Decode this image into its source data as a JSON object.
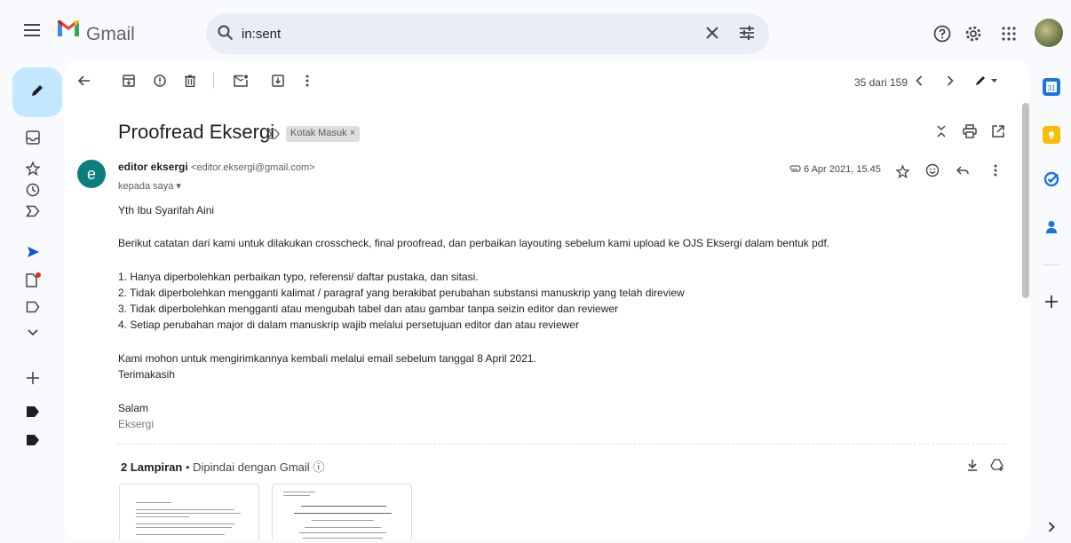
{
  "app": {
    "logo_text": "Gmail"
  },
  "search": {
    "value": "in:sent"
  },
  "toolbar": {
    "counter": "35 dari 159"
  },
  "email": {
    "subject": "Proofread Eksergi",
    "label_chip": "Kotak Masuk ×",
    "sender_avatar_letter": "e",
    "sender_name": "editor eksergi",
    "sender_email": "<editor.eksergi@gmail.com>",
    "to": "kepada saya ▾",
    "date": "6 Apr 2021, 15.45",
    "body": [
      "Yth Ibu Syarifah Aini",
      "Berikut catatan dari kami untuk dilakukan crosscheck, final proofread, dan perbaikan layouting sebelum kami upload ke OJS Eksergi dalam bentuk pdf.",
      "1. Hanya diperbolehkan perbaikan typo, referensi/ daftar pustaka, dan sitasi.",
      "2. Tidak diperbolehkan mengganti kalimat / paragraf yang berakibat perubahan substansi manuskrip yang telah direview",
      "3. Tidak diperbolehkan mengganti atau mengubah tabel dan atau gambar tanpa seizin editor dan reviewer",
      "4. Setiap perubahan major di dalam manuskrip wajib melalui persetujuan editor dan atau reviewer",
      "Kami mohon untuk mengirimkannya kembali melalui email sebelum tanggal 8 April 2021.",
      "Terimakasih",
      "Salam",
      "Eksergi"
    ]
  },
  "attachments": {
    "title": "2 Lampiran",
    "scan_note": "• Dipindai dengan Gmail ⓘ"
  },
  "icons": {
    "menu": "menu-icon",
    "search": "search-icon",
    "clear": "close-icon",
    "filter": "tune-icon",
    "help": "help-icon",
    "settings": "gear-icon",
    "apps": "apps-grid-icon"
  },
  "colors": {
    "compose_bg": "#c2e7ff",
    "accent_blue": "#0b57d0",
    "sender_avatar": "#0b7f7e",
    "draft_dot": "#d93025"
  }
}
